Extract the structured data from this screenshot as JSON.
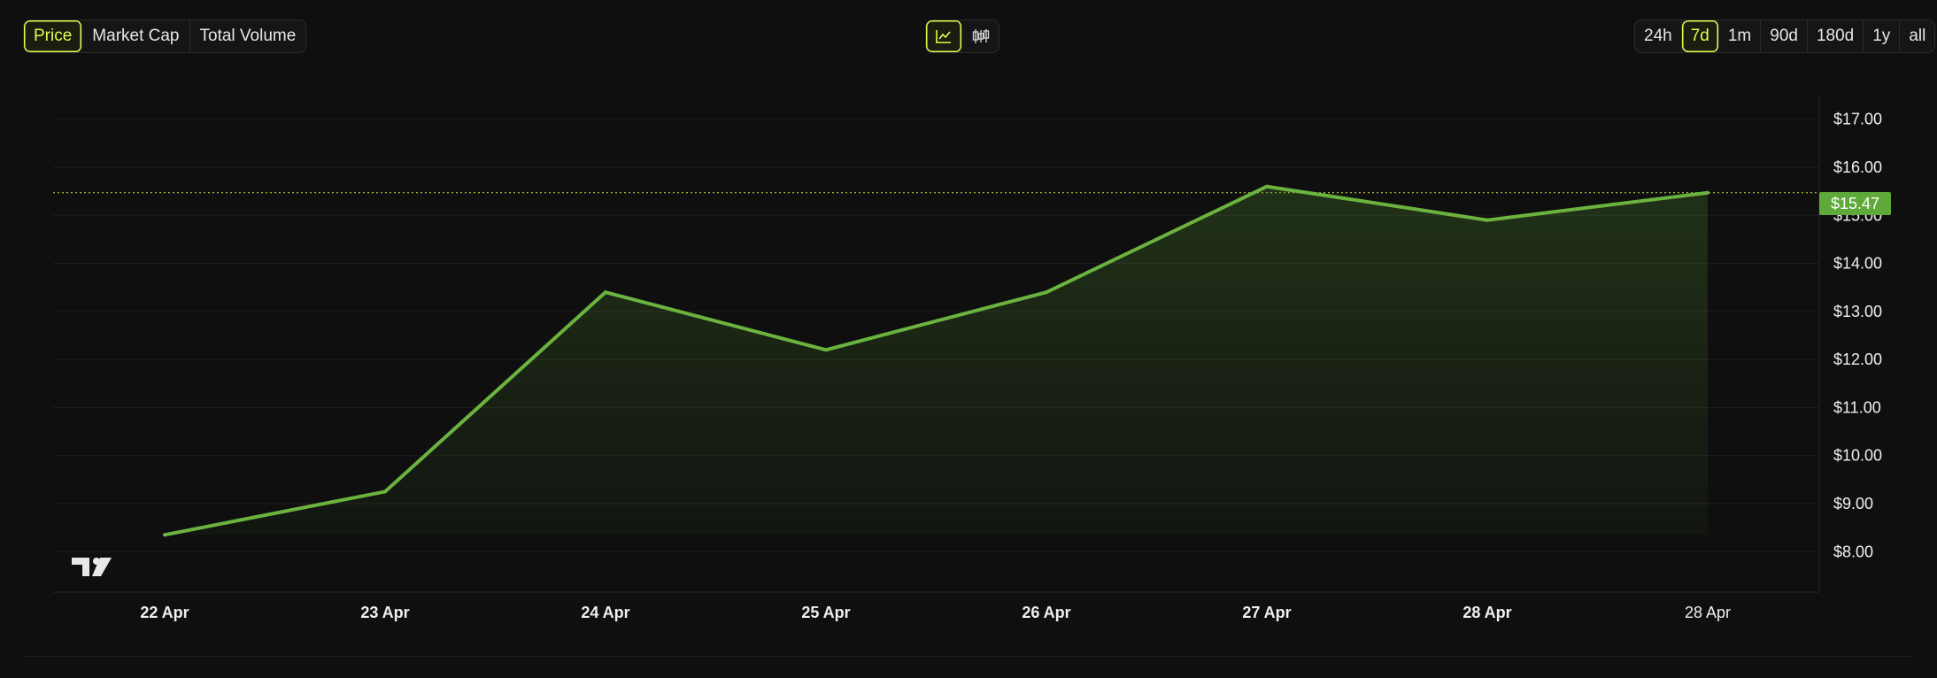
{
  "controls": {
    "metric_tabs": [
      {
        "label": "Price",
        "active": true
      },
      {
        "label": "Market Cap",
        "active": false
      },
      {
        "label": "Total Volume",
        "active": false
      }
    ],
    "chart_type": [
      {
        "icon": "line-chart-icon",
        "active": true
      },
      {
        "icon": "candlestick-chart-icon",
        "active": false
      }
    ],
    "ranges": [
      {
        "label": "24h",
        "active": false
      },
      {
        "label": "7d",
        "active": true
      },
      {
        "label": "1m",
        "active": false
      },
      {
        "label": "90d",
        "active": false
      },
      {
        "label": "180d",
        "active": false
      },
      {
        "label": "1y",
        "active": false
      },
      {
        "label": "all",
        "active": false
      }
    ]
  },
  "current_price_label": "$15.47",
  "colors": {
    "accent": "#dfff4f",
    "line": "#6bb33f",
    "price_tag": "#5fa83a",
    "background": "#0f0f0f"
  },
  "chart_data": {
    "type": "area",
    "x_tick_labels": [
      "22 Apr",
      "23 Apr",
      "24 Apr",
      "25 Apr",
      "26 Apr",
      "27 Apr",
      "28 Apr",
      "28 Apr"
    ],
    "y_tick_labels": [
      "$17.00",
      "$16.00",
      "$15.00",
      "$14.00",
      "$13.00",
      "$12.00",
      "$11.00",
      "$10.00",
      "$9.00",
      "$8.00"
    ],
    "y_ticks": [
      17,
      16,
      15,
      14,
      13,
      12,
      11,
      10,
      9,
      8
    ],
    "ylim": [
      7.25,
      17.75
    ],
    "series": [
      {
        "x_index": [
          0,
          1,
          2,
          3,
          4,
          5,
          6,
          7
        ],
        "values": [
          8.35,
          9.25,
          13.4,
          12.2,
          13.4,
          15.6,
          14.9,
          15.47
        ]
      }
    ],
    "current_value": 15.47,
    "grid": true,
    "watermark": "TV"
  }
}
